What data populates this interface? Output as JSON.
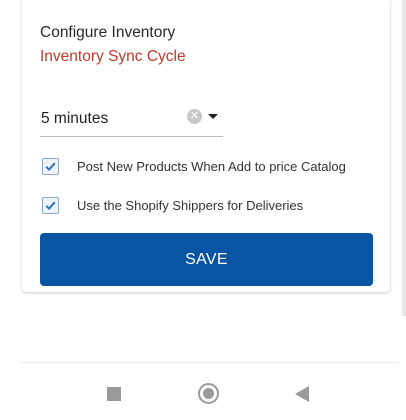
{
  "card": {
    "title": "Configure Inventory",
    "sync_label": "Inventory Sync Cycle",
    "sync_select": {
      "value": "5 minutes",
      "clear_icon": "clear-icon",
      "dropdown_icon": "caret-down-icon"
    },
    "options": [
      {
        "label": "Post New Products When Add to price Catalog",
        "checked": true
      },
      {
        "label": "Use the Shopify Shippers for Deliveries",
        "checked": true
      }
    ],
    "save_label": "SAVE"
  },
  "nav": {
    "recents_icon": "square-icon",
    "home_icon": "circle-icon",
    "back_icon": "back-triangle-icon"
  },
  "colors": {
    "accent_red": "#c0392b",
    "primary_blue": "#0a55a3",
    "checkbox_check": "#2f6fbf"
  }
}
